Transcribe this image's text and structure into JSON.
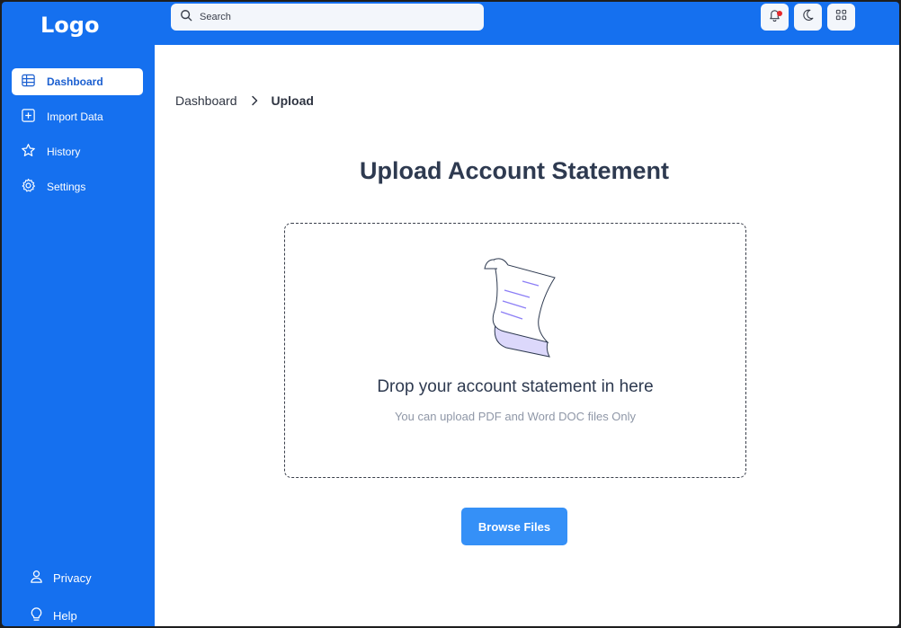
{
  "header": {
    "logo": "Logo",
    "search_placeholder": "Search",
    "icons": [
      "bell-icon",
      "moon-icon",
      "grid-icon"
    ]
  },
  "sidebar": {
    "items": [
      {
        "label": "Dashboard",
        "icon": "table-icon",
        "active": true
      },
      {
        "label": "Import Data",
        "icon": "plus-square-icon",
        "active": false
      },
      {
        "label": "History",
        "icon": "star-icon",
        "active": false
      },
      {
        "label": "Settings",
        "icon": "gear-icon",
        "active": false
      }
    ],
    "bottom": [
      {
        "label": "Privacy",
        "icon": "user-icon"
      },
      {
        "label": "Help",
        "icon": "lightbulb-icon"
      }
    ]
  },
  "main": {
    "breadcrumb": {
      "parent": "Dashboard",
      "current": "Upload"
    },
    "title": "Upload Account Statement",
    "dropzone": {
      "title": "Drop your account statement in here",
      "subtitle": "You can upload PDF and Word DOC files Only"
    },
    "browse_label": "Browse Files"
  },
  "colors": {
    "brand": "#1570ef",
    "button": "#3590f7",
    "heading": "#2e3a50",
    "muted": "#8f97a7",
    "notification": "#e5282c"
  }
}
